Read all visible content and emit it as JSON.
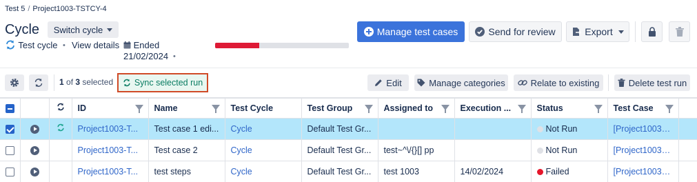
{
  "breadcrumb": {
    "project": "Test 5",
    "separator": "/",
    "key": "Project1003-TSTCY-4"
  },
  "header": {
    "title": "Cycle",
    "switch_label": "Switch cycle",
    "test_cycle_label": "Test cycle",
    "view_details_label": "View details",
    "ended_label": "Ended",
    "ended_date": "21/02/2024",
    "dot": "•"
  },
  "progress": {
    "failed_fraction": 0.33,
    "fill_color": "#de1a36",
    "track_color": "#dfe1e6"
  },
  "actions": {
    "manage_label": "Manage test cases",
    "review_label": "Send for review",
    "export_label": "Export"
  },
  "toolbar": {
    "selected_count": "1",
    "selected_of": "of",
    "selected_total": "3",
    "selected_suffix": "selected",
    "sync_label": "Sync selected run",
    "edit_label": "Edit",
    "categories_label": "Manage categories",
    "relate_label": "Relate to existing",
    "delete_label": "Delete test run"
  },
  "table": {
    "columns": [
      "ID",
      "Name",
      "Test Cycle",
      "Test Group",
      "Assigned to",
      "Execution ...",
      "Status",
      "Test Case"
    ],
    "rows": [
      {
        "checked": true,
        "synced": true,
        "id": "Project1003-T...",
        "name": "Test case 1 edi...",
        "cycle": "Cycle",
        "group": "Default Test Gr...",
        "assigned": "",
        "execution": "",
        "status": "Not Run",
        "status_color": "#dfe1e6",
        "test_case": "[Project1003-T..."
      },
      {
        "checked": false,
        "synced": false,
        "id": "Project1003-T...",
        "name": "Test case 2",
        "cycle": "Cycle",
        "group": "Default Test Gr...",
        "assigned": "test~^\\/{}[] pp",
        "execution": "",
        "status": "Not Run",
        "status_color": "#dfe1e6",
        "test_case": "[Project1003-T..."
      },
      {
        "checked": false,
        "synced": false,
        "id": "Project1003-T...",
        "name": "test steps",
        "cycle": "Cycle",
        "group": "Default Test Gr...",
        "assigned": "test 1003",
        "execution": "14/02/2024",
        "status": "Failed",
        "status_color": "#e5162b",
        "test_case": "[Project1003-T..."
      }
    ]
  },
  "colors": {
    "primary": "#3b73db",
    "link": "#2f66c9",
    "selected_row": "#b3e6fb",
    "sync_accent": "#0a7c62",
    "highlight_border": "#d04a27"
  }
}
